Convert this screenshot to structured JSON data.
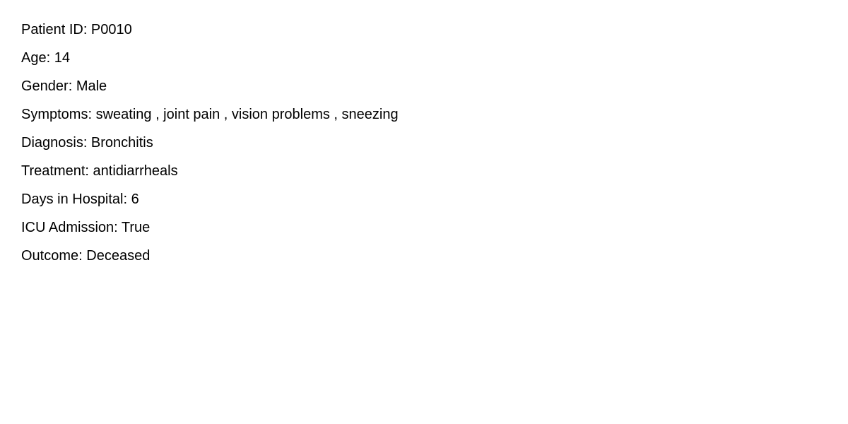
{
  "record": {
    "patient_id": "Patient ID: P0010",
    "age": "Age: 14",
    "gender": "Gender: Male",
    "symptoms": "Symptoms: sweating , joint pain , vision problems , sneezing",
    "diagnosis": "Diagnosis: Bronchitis",
    "treatment": "Treatment: antidiarrheals",
    "days_in_hospital": "Days in Hospital: 6",
    "icu_admission": "ICU Admission: True",
    "outcome": "Outcome: Deceased"
  }
}
